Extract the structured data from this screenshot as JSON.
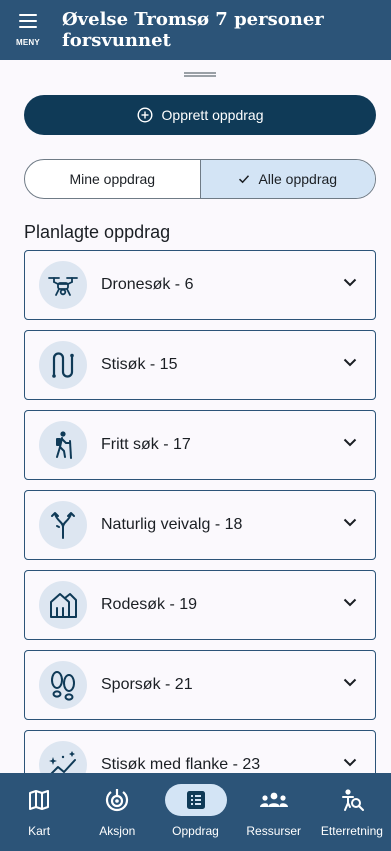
{
  "header": {
    "title": "Øvelse Tromsø 7 personer forsvunnet",
    "menu_label": "MENY",
    "menu_icon": "menu-icon"
  },
  "sheet": {
    "create_button_label": "Opprett oppdrag",
    "filter": {
      "options": [
        "Mine oppdrag",
        "Alle oppdrag"
      ],
      "selected": "Alle oppdrag"
    },
    "section_title": "Planlagte oppdrag",
    "missions": [
      {
        "label": "Dronesøk - 6",
        "icon": "drone-icon"
      },
      {
        "label": "Stisøk - 15",
        "icon": "trail-icon"
      },
      {
        "label": "Fritt søk - 17",
        "icon": "hiker-icon"
      },
      {
        "label": "Naturlig veivalg - 18",
        "icon": "route-fork-icon"
      },
      {
        "label": "Rodesøk - 19",
        "icon": "houses-icon"
      },
      {
        "label": "Sporsøk - 21",
        "icon": "footprints-icon"
      },
      {
        "label": "Stisøk med flanke - 23",
        "icon": "flank-trail-icon"
      }
    ]
  },
  "bottom_nav": {
    "active": "Oppdrag",
    "items": [
      {
        "label": "Kart",
        "icon": "map-icon"
      },
      {
        "label": "Aksjon",
        "icon": "target-icon"
      },
      {
        "label": "Oppdrag",
        "icon": "list-icon"
      },
      {
        "label": "Ressurser",
        "icon": "people-icon"
      },
      {
        "label": "Etterretning",
        "icon": "search-person-icon"
      }
    ]
  },
  "colors": {
    "header": "#2c5478",
    "primary_button": "#0f3a57",
    "selected": "#d3e4f5",
    "icon_circle": "#dde6f1",
    "sheet_background": "#fbf9fd"
  }
}
